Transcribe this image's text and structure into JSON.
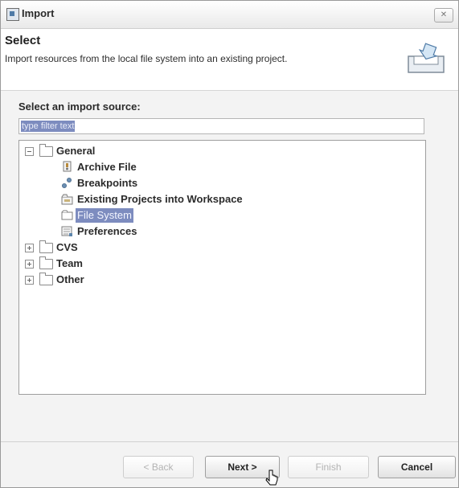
{
  "window": {
    "title": "Import",
    "close_label": "✕"
  },
  "header": {
    "title": "Select",
    "description": "Import resources from the local file system into an existing project."
  },
  "content": {
    "source_label": "Select an import source:",
    "filter_value": "type filter text"
  },
  "tree": {
    "items": [
      {
        "label": "General",
        "expanded": true,
        "level": 0,
        "icon": "folder-icon"
      },
      {
        "label": "Archive File",
        "level": 1,
        "icon": "archive-file-icon"
      },
      {
        "label": "Breakpoints",
        "level": 1,
        "icon": "breakpoints-icon"
      },
      {
        "label": "Existing Projects into Workspace",
        "level": 1,
        "icon": "existing-projects-icon"
      },
      {
        "label": "File System",
        "level": 1,
        "icon": "file-system-icon",
        "selected": true
      },
      {
        "label": "Preferences",
        "level": 1,
        "icon": "preferences-icon"
      },
      {
        "label": "CVS",
        "expanded": false,
        "level": 0,
        "icon": "folder-icon"
      },
      {
        "label": "Team",
        "expanded": false,
        "level": 0,
        "icon": "folder-icon"
      },
      {
        "label": "Other",
        "expanded": false,
        "level": 0,
        "icon": "folder-icon"
      }
    ]
  },
  "buttons": {
    "back": "< Back",
    "next": "Next >",
    "finish": "Finish",
    "cancel": "Cancel"
  },
  "colors": {
    "selection": "#7d8cbf"
  }
}
